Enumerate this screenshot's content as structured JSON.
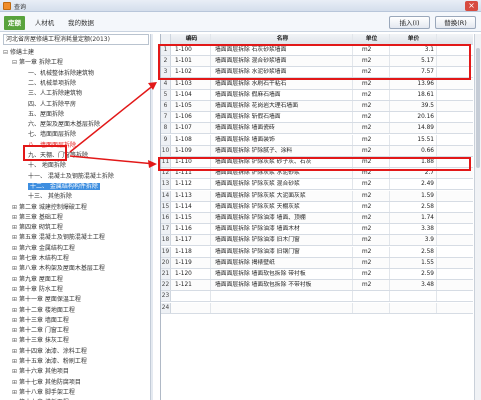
{
  "window": {
    "title": "查询"
  },
  "tabs": [
    {
      "label": "定额",
      "active": true
    },
    {
      "label": "人材机",
      "active": false
    },
    {
      "label": "我的数据",
      "active": false
    }
  ],
  "toolbar": {
    "insert_label": "插入(I)",
    "replace_label": "替换(R)"
  },
  "library": {
    "name": "河北省房屋修缮工程消耗量定额(2013)"
  },
  "tree": [
    {
      "label": "修缮土建",
      "indent": 0,
      "exp": "⊟"
    },
    {
      "label": "第一章 拆除工程",
      "indent": 1,
      "exp": "⊟"
    },
    {
      "label": "一、机械整体拆除建筑物",
      "indent": 2,
      "exp": ""
    },
    {
      "label": "二、机械单项拆除",
      "indent": 2,
      "exp": ""
    },
    {
      "label": "三、人工拆除建筑物",
      "indent": 2,
      "exp": ""
    },
    {
      "label": "四、人工拆除平房",
      "indent": 2,
      "exp": ""
    },
    {
      "label": "五、屋面拆除",
      "indent": 2,
      "exp": ""
    },
    {
      "label": "六、屋架及屋面木基层拆除",
      "indent": 2,
      "exp": ""
    },
    {
      "label": "七、墙面面层拆除",
      "indent": 2,
      "exp": ""
    },
    {
      "label": "八、墙面面层拆除",
      "indent": 2,
      "exp": "",
      "state": "red"
    },
    {
      "label": "九、天棚、门窗等拆除",
      "indent": 2,
      "exp": ""
    },
    {
      "label": "十、 地面拆除",
      "indent": 2,
      "exp": ""
    },
    {
      "label": "十一、 混凝土及钢筋混凝土拆除",
      "indent": 2,
      "exp": ""
    },
    {
      "label": "十二、 金属结构构件拆除",
      "indent": 2,
      "exp": "",
      "state": "blue"
    },
    {
      "label": "十三、 其他拆除",
      "indent": 2,
      "exp": ""
    },
    {
      "label": "第二章 城建控制爆破工程",
      "indent": 1,
      "exp": "⊞"
    },
    {
      "label": "第三章 基础工程",
      "indent": 1,
      "exp": "⊞"
    },
    {
      "label": "第四章 砌筑工程",
      "indent": 1,
      "exp": "⊞"
    },
    {
      "label": "第五章 混凝土及钢筋混凝土工程",
      "indent": 1,
      "exp": "⊞"
    },
    {
      "label": "第六章 金属结构工程",
      "indent": 1,
      "exp": "⊞"
    },
    {
      "label": "第七章 木结构工程",
      "indent": 1,
      "exp": "⊞"
    },
    {
      "label": "第八章 木构架及屋面木基层工程",
      "indent": 1,
      "exp": "⊞"
    },
    {
      "label": "第九章 屋面工程",
      "indent": 1,
      "exp": "⊞"
    },
    {
      "label": "第十章 防水工程",
      "indent": 1,
      "exp": "⊞"
    },
    {
      "label": "第十一章 屋面保温工程",
      "indent": 1,
      "exp": "⊞"
    },
    {
      "label": "第十二章 楼地面工程",
      "indent": 1,
      "exp": "⊞"
    },
    {
      "label": "第十三章 墙面工程",
      "indent": 1,
      "exp": "⊞"
    },
    {
      "label": "第十二章 门窗工程",
      "indent": 1,
      "exp": "⊞"
    },
    {
      "label": "第十三章 抹灰工程",
      "indent": 1,
      "exp": "⊞"
    },
    {
      "label": "第十四章 油漆、涂料工程",
      "indent": 1,
      "exp": "⊞"
    },
    {
      "label": "第十五章 油漆、粉刷工程",
      "indent": 1,
      "exp": "⊞"
    },
    {
      "label": "第十六章 其他项目",
      "indent": 1,
      "exp": "⊞"
    },
    {
      "label": "第十七章 其他防腐项目",
      "indent": 1,
      "exp": "⊞"
    },
    {
      "label": "第十八章 脚手架工程",
      "indent": 1,
      "exp": "⊞"
    },
    {
      "label": "第十九章 模板工程",
      "indent": 1,
      "exp": "⊞"
    },
    {
      "label": "第二十章 垂直运输工程",
      "indent": 1,
      "exp": "⊞"
    }
  ],
  "table": {
    "headers": {
      "num": "",
      "code": "编码",
      "name": "名称",
      "unit": "单位",
      "price": "单价"
    },
    "rows": [
      {
        "num": "1",
        "code": "1-100",
        "name": "墙面面层拆除 石灰砂浆墙面",
        "unit": "m2",
        "price": "3.1"
      },
      {
        "num": "2",
        "code": "1-101",
        "name": "墙面面层拆除 混合砂浆墙面",
        "unit": "m2",
        "price": "5.17"
      },
      {
        "num": "3",
        "code": "1-102",
        "name": "墙面面层拆除 水泥砂浆墙面",
        "unit": "m2",
        "price": "7.57"
      },
      {
        "num": "4",
        "code": "1-103",
        "name": "墙面面层拆除 水刷石干粘石",
        "unit": "m2",
        "price": "13.96"
      },
      {
        "num": "5",
        "code": "1-104",
        "name": "墙面面层拆除 假麻石墙面",
        "unit": "m2",
        "price": "18.61"
      },
      {
        "num": "6",
        "code": "1-105",
        "name": "墙面面层拆除 花岗岩大理石墙面",
        "unit": "m2",
        "price": "39.5"
      },
      {
        "num": "7",
        "code": "1-106",
        "name": "墙面面层拆除 斩假石墙面",
        "unit": "m2",
        "price": "20.16"
      },
      {
        "num": "8",
        "code": "1-107",
        "name": "墙面面层拆除 墙面瓷砖",
        "unit": "m2",
        "price": "14.89"
      },
      {
        "num": "9",
        "code": "1-108",
        "name": "墙面面层拆除 墙面装饰",
        "unit": "m2",
        "price": "15.51"
      },
      {
        "num": "10",
        "code": "1-109",
        "name": "墙面面层拆除 铲除腻子、涂料",
        "unit": "m2",
        "price": "0.66"
      },
      {
        "num": "11",
        "code": "1-110",
        "name": "墙面面层拆除 铲除灰浆 砂子灰、石灰",
        "unit": "m2",
        "price": "1.88"
      },
      {
        "num": "12",
        "code": "1-111",
        "name": "墙面面层拆除 铲除灰浆 水泥砂浆",
        "unit": "m2",
        "price": "2.7"
      },
      {
        "num": "13",
        "code": "1-112",
        "name": "墙面面层拆除 铲除灰浆 混合砂浆",
        "unit": "m2",
        "price": "2.49"
      },
      {
        "num": "14",
        "code": "1-113",
        "name": "墙面面层拆除 铲除灰浆 大泥面灰浆",
        "unit": "m2",
        "price": "1.59"
      },
      {
        "num": "15",
        "code": "1-114",
        "name": "墙面面层拆除 铲除灰浆 天棚灰浆",
        "unit": "m2",
        "price": "2.58"
      },
      {
        "num": "16",
        "code": "1-115",
        "name": "墙面面层拆除 铲除油漆 墙面、顶棚",
        "unit": "m2",
        "price": "1.74"
      },
      {
        "num": "17",
        "code": "1-116",
        "name": "墙面面层拆除 铲除油漆 墙面木材",
        "unit": "m2",
        "price": "3.38"
      },
      {
        "num": "18",
        "code": "1-117",
        "name": "墙面面层拆除 铲除油漆 旧木门窗",
        "unit": "m2",
        "price": "3.9"
      },
      {
        "num": "19",
        "code": "1-118",
        "name": "墙面面层拆除 铲除油漆 旧钢门窗",
        "unit": "m2",
        "price": "2.58"
      },
      {
        "num": "20",
        "code": "1-119",
        "name": "墙面面层拆除 揭裱壁纸",
        "unit": "m2",
        "price": "1.55"
      },
      {
        "num": "21",
        "code": "1-120",
        "name": "墙面面层拆除 墙面软包拆除 带衬板",
        "unit": "m2",
        "price": "2.59"
      },
      {
        "num": "22",
        "code": "1-121",
        "name": "墙面面层拆除 墙面软包拆除 不带衬板",
        "unit": "m2",
        "price": "3.48"
      },
      {
        "num": "23",
        "code": "",
        "name": "",
        "unit": "",
        "price": ""
      },
      {
        "num": "24",
        "code": "",
        "name": "",
        "unit": "",
        "price": ""
      }
    ]
  },
  "colors": {
    "accent_green": "#59a33d",
    "highlight_red": "#e21818",
    "selection_blue": "#3d8ee0"
  }
}
